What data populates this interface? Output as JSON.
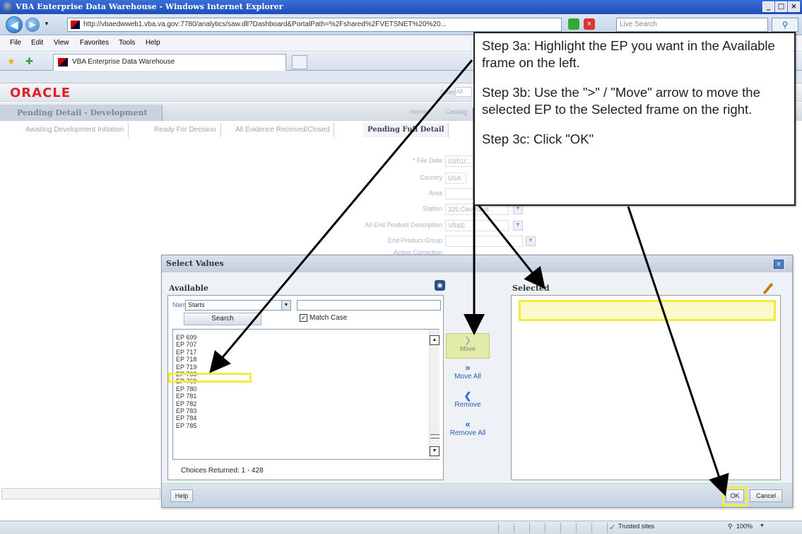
{
  "window": {
    "title": "VBA Enterprise Data Warehouse - Windows Internet Explorer",
    "min": "_",
    "max": "□",
    "close": "×"
  },
  "browser": {
    "url": "http://vbaedwweb1.vba.va.gov:7780/analytics/saw.dll?Dashboard&PortalPath=%2Fshared%2FVETSNET%20%20...",
    "search_placeholder": "Live Search",
    "menus": [
      "File",
      "Edit",
      "View",
      "Favorites",
      "Tools",
      "Help"
    ],
    "tab_title": "VBA Enterprise Data Warehouse"
  },
  "page": {
    "brand": "ORACLE",
    "dashboard_title": "Pending Detail - Development",
    "header_right": [
      "Search",
      "All",
      "Home",
      "Catalog"
    ],
    "tabs": [
      "Awaiting Development Initiation",
      "Ready For Decision",
      "All Evidence Received/Closed",
      "Pending Full Detail"
    ],
    "prompts": [
      {
        "label": "* File Date",
        "value": "03/01/..."
      },
      {
        "label": "Country",
        "value": "USA"
      },
      {
        "label": "Area",
        "value": ""
      },
      {
        "label": "Station",
        "value": "325 Cleveland"
      },
      {
        "label": "All End Product Description",
        "value": "VR&E"
      },
      {
        "label": "End Product Group",
        "value": ""
      },
      {
        "label": "Action Correction",
        "value": ""
      }
    ]
  },
  "dialog": {
    "title": "Select Values",
    "available_label": "Available",
    "selected_label": "Selected",
    "name_label": "Name",
    "match_operator": "Starts",
    "search_button": "Search",
    "match_case_label": "Match Case",
    "items": [
      "EP 699",
      "EP 707",
      "EP 717",
      "EP 718",
      "EP 719",
      "EP 768",
      "EP 769",
      "EP 780",
      "EP 781",
      "EP 782",
      "EP 783",
      "EP 784",
      "EP 785"
    ],
    "choices_returned": "Choices Returned:  1 - 428",
    "move_label": "Move",
    "move_all_label": "Move All",
    "remove_label": "Remove",
    "remove_all_label": "Remove All",
    "help_button": "Help",
    "ok_button": "OK",
    "cancel_button": "Cancel"
  },
  "statusbar": {
    "zone": "Trusted sites",
    "zoom": "100%"
  },
  "callout": {
    "step_3a": "Step 3a: Highlight the EP you want in the Available frame on the left.",
    "step_3b": "Step 3b:  Use the \">\" / \"Move\" arrow to move the selected EP to the Selected frame on the right.",
    "step_3c": "Step 3c: Click \"OK\""
  },
  "colors": {
    "highlight": "#f4ec3b",
    "oracle_red": "#dd2222",
    "titlebar_blue": "#1f4fb8"
  }
}
